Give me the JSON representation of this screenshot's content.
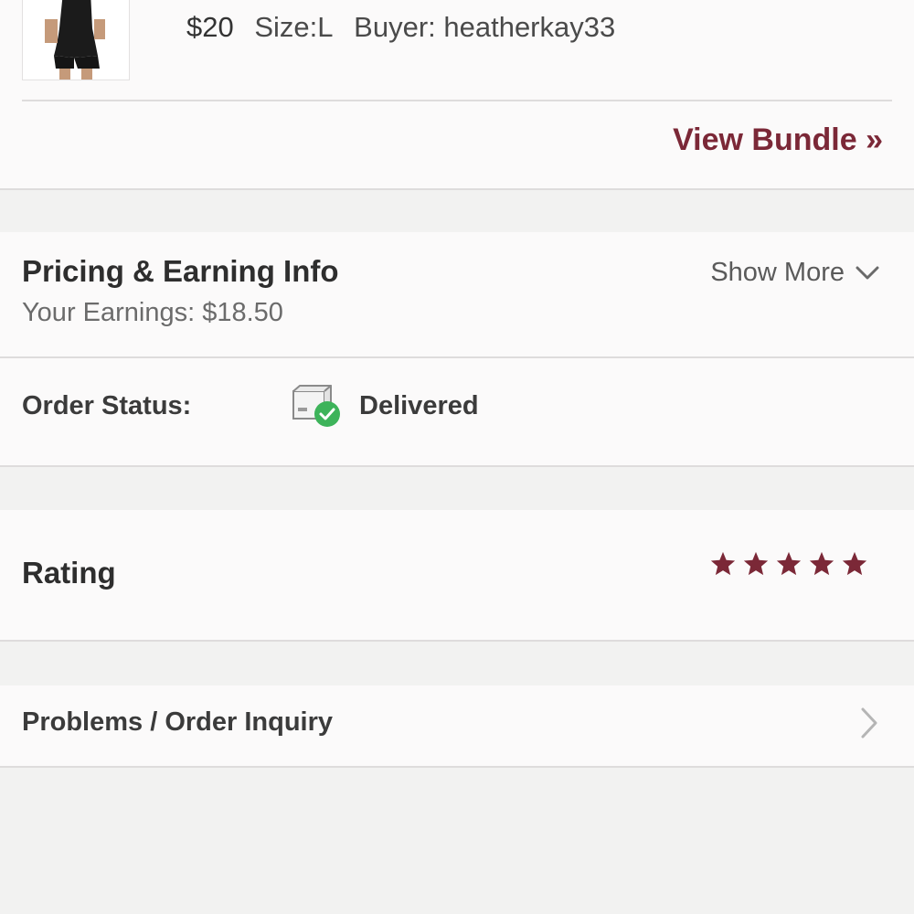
{
  "item": {
    "price": "$20",
    "size": "Size:L",
    "buyer": "Buyer: heatherkay33",
    "view_bundle_label": "View Bundle »"
  },
  "pricing": {
    "title": "Pricing & Earning Info",
    "earnings": "Your Earnings: $18.50",
    "show_more_label": "Show More"
  },
  "order_status": {
    "label": "Order Status:",
    "value": "Delivered",
    "icon": "package-delivered-icon"
  },
  "rating": {
    "label": "Rating",
    "stars": 5,
    "max_stars": 5
  },
  "problems": {
    "label": "Problems / Order Inquiry"
  },
  "colors": {
    "accent": "#7b2837",
    "delivered_green": "#3db35a"
  }
}
